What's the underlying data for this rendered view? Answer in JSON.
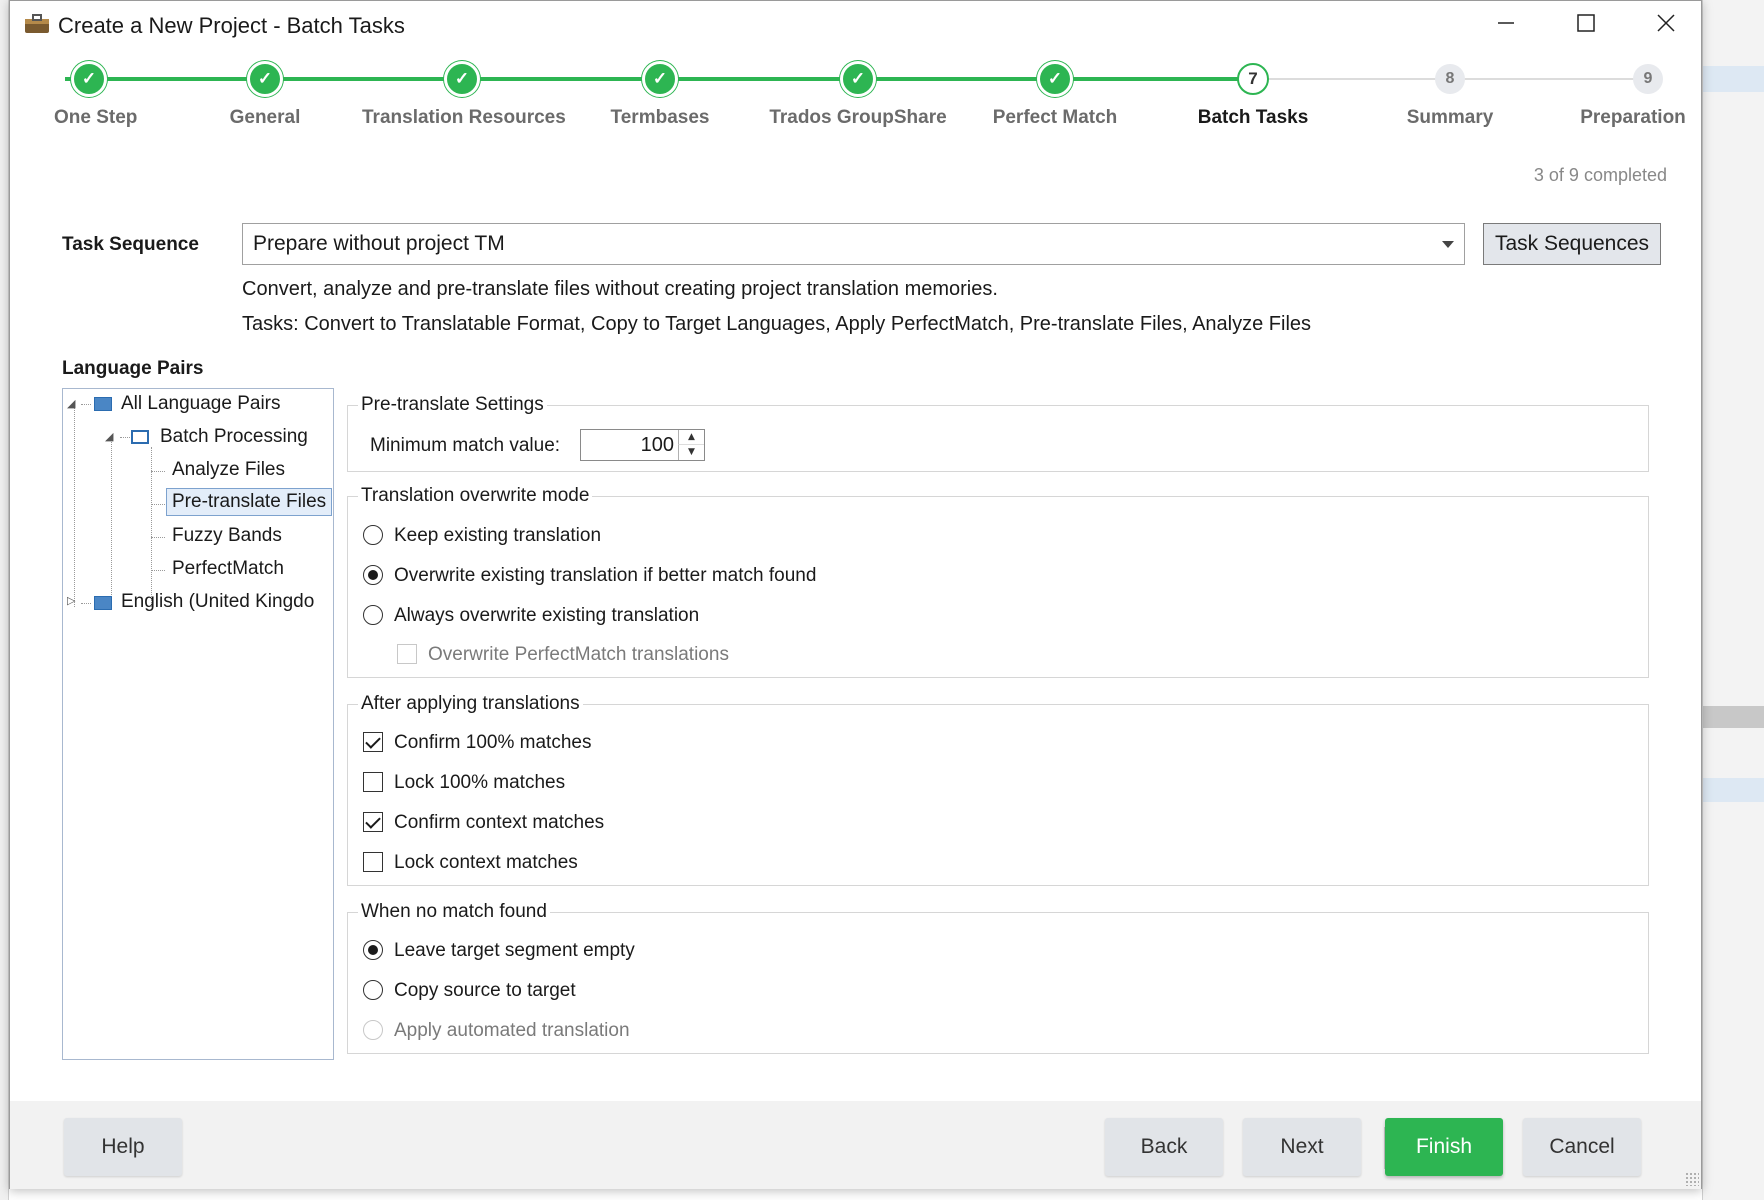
{
  "window": {
    "title": "Create a New Project - Batch Tasks",
    "controls": [
      "minimize",
      "maximize",
      "close"
    ]
  },
  "wizard": {
    "steps": [
      {
        "label": "One Step",
        "state": "done"
      },
      {
        "label": "General",
        "state": "done"
      },
      {
        "label": "Translation Resources",
        "state": "done"
      },
      {
        "label": "Termbases",
        "state": "done"
      },
      {
        "label": "Trados GroupShare",
        "state": "done"
      },
      {
        "label": "Perfect Match",
        "state": "done"
      },
      {
        "label": "Batch Tasks",
        "state": "current",
        "number": "7"
      },
      {
        "label": "Summary",
        "state": "todo",
        "number": "8"
      },
      {
        "label": "Preparation",
        "state": "todo",
        "number": "9"
      }
    ],
    "progress": "3 of 9 completed",
    "accent_color": "#2db552"
  },
  "task_sequence": {
    "label": "Task Sequence",
    "value": "Prepare without project TM",
    "button": "Task Sequences",
    "description": "Convert, analyze and pre-translate files without creating project translation memories.",
    "tasks": "Tasks: Convert to Translatable Format, Copy to Target Languages, Apply PerfectMatch, Pre-translate Files, Analyze Files"
  },
  "language_pairs": {
    "label": "Language Pairs",
    "tree": [
      {
        "label": "All Language Pairs",
        "expanded": true
      },
      {
        "label": "Batch Processing",
        "expanded": true
      },
      {
        "label": "Analyze Files"
      },
      {
        "label": "Pre-translate Files",
        "selected": true
      },
      {
        "label": "Fuzzy Bands"
      },
      {
        "label": "PerfectMatch"
      },
      {
        "label": "English (United Kingdo",
        "expanded": false
      }
    ]
  },
  "pretranslate": {
    "title": "Pre-translate Settings",
    "min_match_label": "Minimum match value:",
    "min_match_value": "100"
  },
  "overwrite_mode": {
    "title": "Translation overwrite mode",
    "options": [
      {
        "label": "Keep existing translation",
        "checked": false
      },
      {
        "label": "Overwrite existing translation if better match found",
        "checked": true
      },
      {
        "label": "Always overwrite existing translation",
        "checked": false
      }
    ],
    "perfectmatch_label": "Overwrite PerfectMatch translations",
    "perfectmatch_checked": false,
    "perfectmatch_enabled": false
  },
  "after_applying": {
    "title": "After applying translations",
    "options": [
      {
        "label": "Confirm 100% matches",
        "checked": true
      },
      {
        "label": "Lock 100% matches",
        "checked": false
      },
      {
        "label": "Confirm context matches",
        "checked": true
      },
      {
        "label": "Lock context matches",
        "checked": false
      }
    ]
  },
  "no_match": {
    "title": "When no match found",
    "options": [
      {
        "label": "Leave target segment empty",
        "checked": true,
        "enabled": true
      },
      {
        "label": "Copy source to target",
        "checked": false,
        "enabled": true
      },
      {
        "label": "Apply automated translation",
        "checked": false,
        "enabled": false
      }
    ]
  },
  "footer": {
    "help": "Help",
    "back": "Back",
    "next": "Next",
    "finish": "Finish",
    "cancel": "Cancel"
  }
}
